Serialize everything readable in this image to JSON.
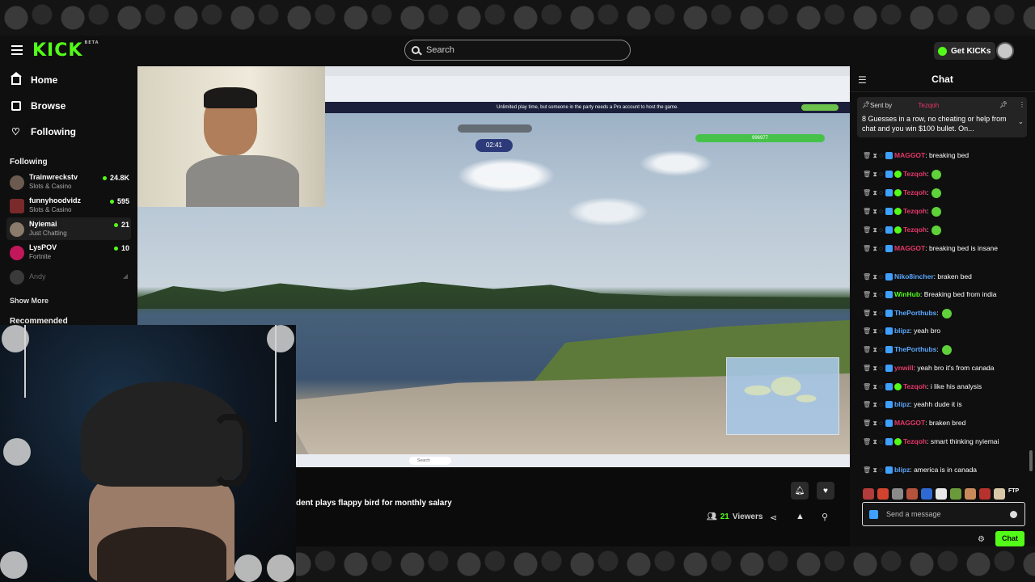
{
  "nav": {
    "search_placeholder": "Search",
    "get_kicks_label": "Get KICKs",
    "logo_text": "KICK",
    "logo_badge": "BETA"
  },
  "sidebar": {
    "main": [
      {
        "label": "Home",
        "icon": "home-icon"
      },
      {
        "label": "Browse",
        "icon": "browse-icon"
      },
      {
        "label": "Following",
        "icon": "heart-icon"
      }
    ],
    "following_header": "Following",
    "following": [
      {
        "name": "Trainwreckstv",
        "category": "Slots & Casino",
        "viewers": "24.8K"
      },
      {
        "name": "funnyhoodvidz",
        "category": "Slots & Casino",
        "viewers": "595"
      },
      {
        "name": "Nyiemai",
        "category": "Just Chatting",
        "viewers": "21"
      },
      {
        "name": "LysPOV",
        "category": "Fortnite",
        "viewers": "10"
      },
      {
        "name": "Andy",
        "category": "",
        "viewers": ""
      }
    ],
    "show_more": "Show More",
    "recommended_header": "Recommended"
  },
  "video": {
    "timer": "02:41",
    "banner": "Unlimited play time, but someone in the party needs a Pro account to host the game.",
    "score": "996977",
    "taskbar_search": "Search"
  },
  "stream": {
    "title": "dent plays flappy bird for monthly salary",
    "viewers_count": "21",
    "viewers_label": "Viewers"
  },
  "chat": {
    "title": "Chat",
    "pinned": {
      "sent_by": "Sent by",
      "user": "Tezqoh",
      "text": "8 Guesses in a row, no cheating or help from chat and you win $100 bullet. On..."
    },
    "messages": [
      {
        "user": "MAGGOT",
        "text": ": breaking bed",
        "color": "#e8386a"
      },
      {
        "user": "Tezqoh",
        "text": ":",
        "color": "#e8386a"
      },
      {
        "user": "Tezqoh",
        "text": ":",
        "color": "#e8386a"
      },
      {
        "user": "Tezqoh",
        "text": ":",
        "color": "#e8386a"
      },
      {
        "user": "Tezqoh",
        "text": ":",
        "color": "#e8386a"
      },
      {
        "user": "MAGGOT",
        "text": ": breaking bed is insane",
        "color": "#e8386a"
      },
      {
        "user": "Niko8incher",
        "text": ": braken bed",
        "color": "#5aa8ff"
      },
      {
        "user": "WinHub",
        "text": ": Breaking bed from india",
        "color": "#53fc18"
      },
      {
        "user": "ThePorthubs",
        "text": ":",
        "color": "#5aa8ff"
      },
      {
        "user": "blipz",
        "text": ": yeah bro",
        "color": "#5aa8ff"
      },
      {
        "user": "ThePorthubs",
        "text": ":",
        "color": "#5aa8ff"
      },
      {
        "user": "ynwill",
        "text": ": yeah bro it's from canada",
        "color": "#e8386a"
      },
      {
        "user": "Tezqoh",
        "text": ": i like his analysis",
        "color": "#e8386a"
      },
      {
        "user": "blipz",
        "text": ": yeahh dude it is",
        "color": "#5aa8ff"
      },
      {
        "user": "MAGGOT",
        "text": ": braken bred",
        "color": "#e8386a"
      },
      {
        "user": "Tezqoh",
        "text": ": smart thinking nyiemai",
        "color": "#e8386a"
      },
      {
        "user": "blipz",
        "text": ": america is in canada",
        "color": "#5aa8ff"
      }
    ],
    "emote_ftp": "FTP",
    "input_placeholder": "Send a message",
    "send_label": "Chat"
  },
  "colors": {
    "brand": "#53fc18",
    "background": "#0f0f0f"
  }
}
